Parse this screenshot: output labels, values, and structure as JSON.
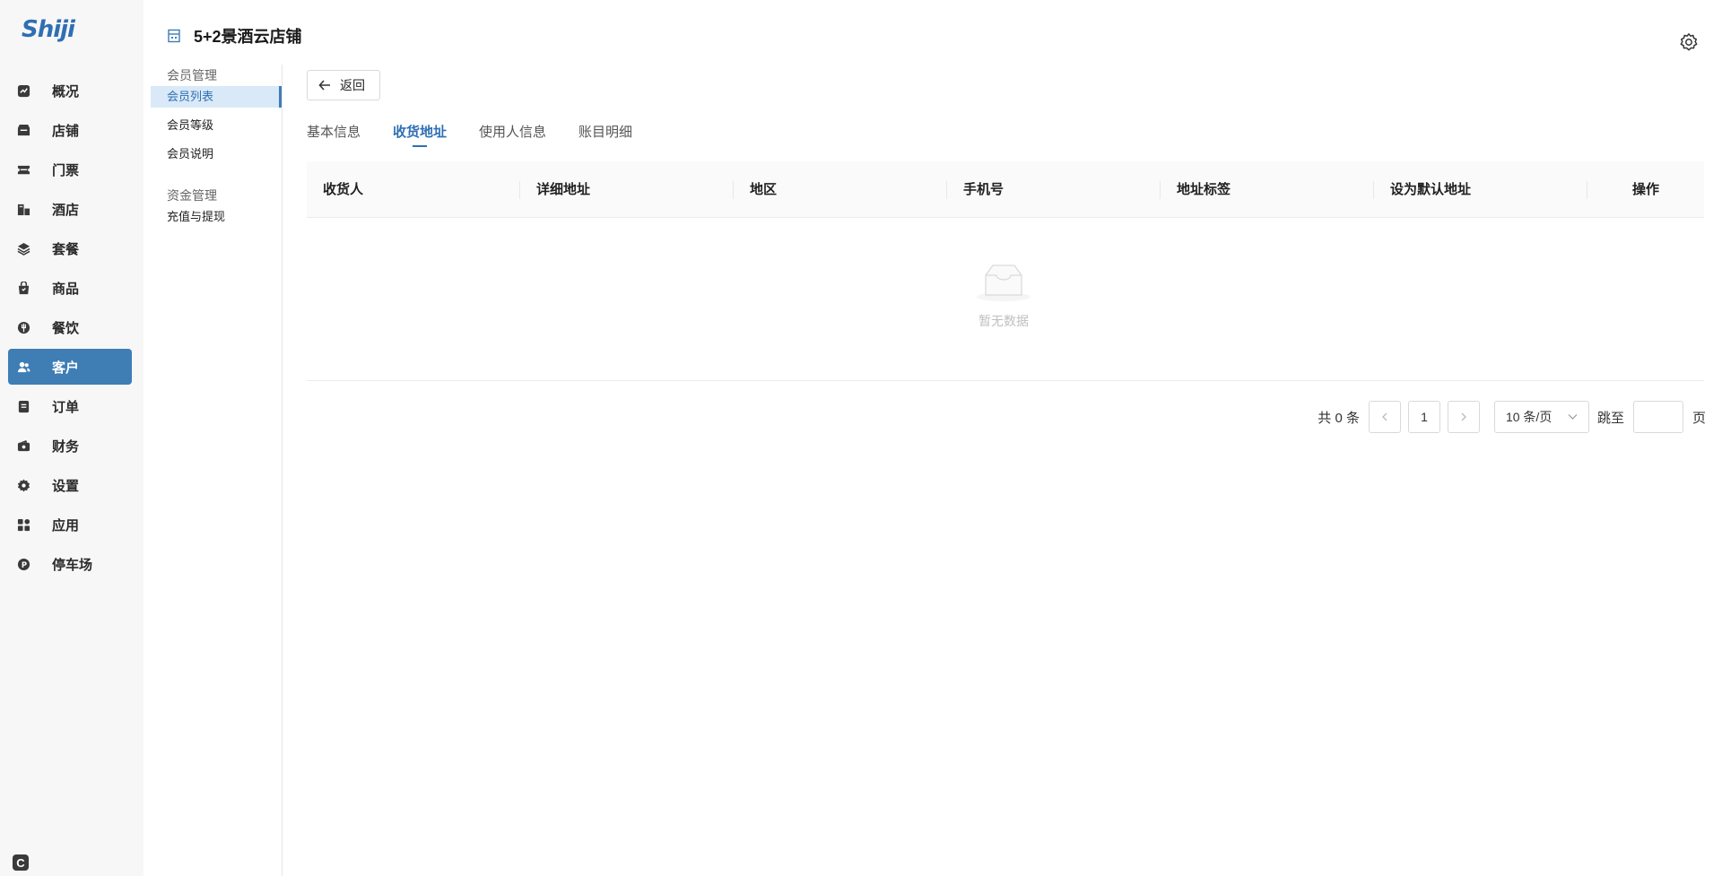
{
  "app": {
    "logo_text": "Shiji"
  },
  "sidebar": {
    "items": [
      {
        "label": "概况",
        "icon": "chart-icon"
      },
      {
        "label": "店铺",
        "icon": "shop-icon"
      },
      {
        "label": "门票",
        "icon": "ticket-icon"
      },
      {
        "label": "酒店",
        "icon": "hotel-icon"
      },
      {
        "label": "套餐",
        "icon": "layers-icon"
      },
      {
        "label": "商品",
        "icon": "bag-icon"
      },
      {
        "label": "餐饮",
        "icon": "dining-icon"
      },
      {
        "label": "客户",
        "icon": "users-icon",
        "active": true
      },
      {
        "label": "订单",
        "icon": "order-icon"
      },
      {
        "label": "财务",
        "icon": "wallet-icon"
      },
      {
        "label": "设置",
        "icon": "gear-icon"
      },
      {
        "label": "应用",
        "icon": "apps-icon"
      },
      {
        "label": "停车场",
        "icon": "parking-icon"
      }
    ],
    "bottom_icon": "C"
  },
  "header": {
    "store_name": "5+2景酒云店铺"
  },
  "submenu": {
    "group1": {
      "title": "会员管理",
      "items": [
        "会员列表",
        "会员等级",
        "会员说明"
      ]
    },
    "group2": {
      "title": "资金管理",
      "items": [
        "充值与提现"
      ]
    }
  },
  "main": {
    "back_label": "返回",
    "tabs": [
      "基本信息",
      "收货地址",
      "使用人信息",
      "账目明细"
    ],
    "active_tab": "收货地址",
    "table": {
      "columns": [
        "收货人",
        "详细地址",
        "地区",
        "手机号",
        "地址标签",
        "设为默认地址",
        "操作"
      ],
      "rows": [],
      "empty_text": "暂无数据"
    },
    "pagination": {
      "total_text": "共 0 条",
      "current_page": "1",
      "page_size": "10 条/页",
      "jump_label": "跳至",
      "page_suffix": "页"
    }
  },
  "colors": {
    "accent": "#3f7db5",
    "link": "#2f6fb3"
  }
}
